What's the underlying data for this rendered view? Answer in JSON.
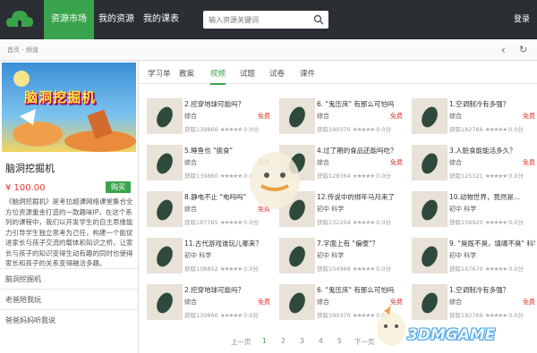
{
  "nav": {
    "items": [
      "资源市场",
      "我的资源",
      "我的课表"
    ],
    "search_placeholder": "输入资源关键词",
    "login": "登录"
  },
  "breadcrumb": "首页 - 频道",
  "course": {
    "cover_title": "脑洞挖掘机",
    "title": "脑洞挖掘机",
    "price": "¥ 100.00",
    "buy": "购买",
    "description": "《脑洞挖掘机》是考拉超课网络课堂集合全方位资源重金打造的一款趣味IP，在这个系列的课程中，我们以开发学生的自主思维能力引导学生独立思考为己任，构建一个能促进家长与孩子交流的载体和知识之桥，让家长与孩子的知识变得生动有趣的同时也使得家长和孩子的关系变得融洽多趣。"
  },
  "side_list": [
    "脑洞挖掘机",
    "老爸陪我玩",
    "爸爸妈妈听我说"
  ],
  "tabs": [
    "学习单",
    "教案",
    "视频",
    "试题",
    "试卷",
    "课件"
  ],
  "active_tab": 2,
  "cards": [
    {
      "title": "2.挖穿地球可能吗？",
      "tag": "综合",
      "free": "免费",
      "stats": "获取139866",
      "score": "0.0分"
    },
    {
      "title": "6. \"鬼压床\" 有那么可怕吗",
      "tag": "综合",
      "free": "免费",
      "stats": "获取190370",
      "score": "0.0分"
    },
    {
      "title": "1.空调制冷有多强？",
      "tag": "综合",
      "free": "免费",
      "stats": "获取182766",
      "score": "0.0分"
    },
    {
      "title": "5.睡鱼也 \"挑食\"",
      "tag": "综合",
      "free": "免费",
      "stats": "获取139860",
      "score": "0.0分"
    },
    {
      "title": "4.过了期的食品还能吗吃？",
      "tag": "综合",
      "free": "免费",
      "stats": "获取128364",
      "score": "0.0分"
    },
    {
      "title": "3.人脏食能能活多久？",
      "tag": "综合",
      "free": "免费",
      "stats": "获取125321",
      "score": "0.0分"
    },
    {
      "title": "8.静电不止 \"电吗吗\"",
      "tag": "综合",
      "free": "免费",
      "stats": "获取187765",
      "score": "0.0分"
    },
    {
      "title": "12.传说中的绑年马月来了",
      "tag": "初中 科学",
      "free": "",
      "stats": "获取232204",
      "score": "0.0分"
    },
    {
      "title": "10.动物世界，竟然是...",
      "tag": "初中 科学",
      "free": "",
      "stats": "获取158920",
      "score": "0.0分"
    },
    {
      "title": "11.古代游戏谁玩儿哪来？",
      "tag": "初中 科学",
      "free": "",
      "stats": "获取108852",
      "score": "0.0分"
    },
    {
      "title": "7.字面上有 \"偏傻\"？",
      "tag": "初中 科学",
      "free": "",
      "stats": "获取104968",
      "score": "0.0分"
    },
    {
      "title": "9. \"臭既不臭，填哪不臭\" 科学吗？",
      "tag": "初中 科学",
      "free": "",
      "stats": "获取167670",
      "score": "0.0分"
    },
    {
      "title": "2.挖穿地球可能吗？",
      "tag": "综合",
      "free": "免费",
      "stats": "获取139866",
      "score": "0.0分"
    },
    {
      "title": "6. \"鬼压床\" 有那么可怕吗",
      "tag": "综合",
      "free": "免费",
      "stats": "获取190370",
      "score": "0.0分"
    },
    {
      "title": "1.空调制冷有多强？",
      "tag": "综合",
      "free": "免费",
      "stats": "获取182766",
      "score": "0.0分"
    }
  ],
  "stars": "★★★★★",
  "pager": {
    "prev": "上一页",
    "pages": [
      "1",
      "2",
      "3",
      "4",
      "5"
    ],
    "next": "下一页",
    "active": 0
  },
  "watermark": "3DMGAME",
  "colors": {
    "accent": "#3aa44d",
    "topbar": "#2b2e33",
    "price": "#e0392f"
  }
}
